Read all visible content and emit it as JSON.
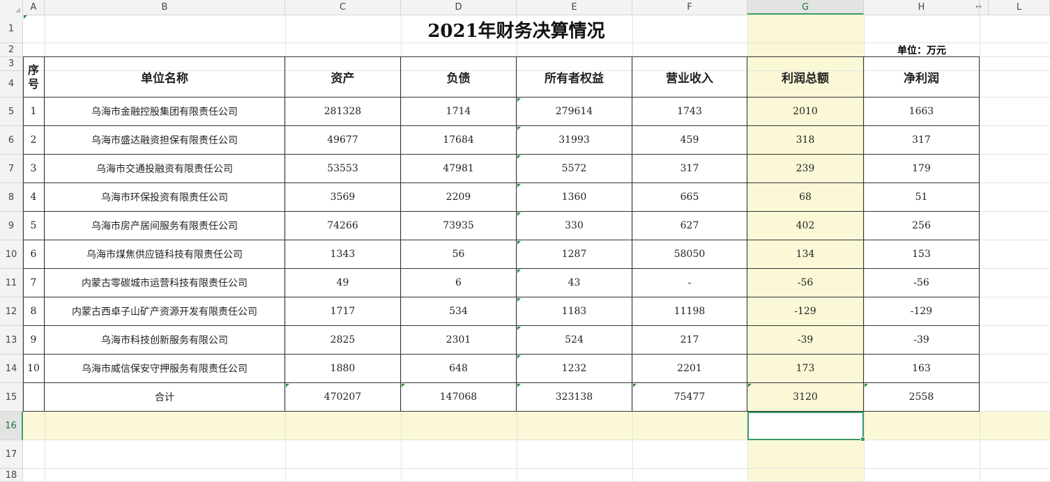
{
  "columns": [
    "A",
    "B",
    "C",
    "D",
    "E",
    "F",
    "G",
    "H",
    "",
    "L"
  ],
  "rows": [
    "1",
    "2",
    "3",
    "4",
    "5",
    "6",
    "7",
    "8",
    "9",
    "10",
    "11",
    "12",
    "13",
    "14",
    "15",
    "16",
    "17",
    "18"
  ],
  "title": "2021年财务决算情况",
  "unit": "单位：万元",
  "headers": {
    "seq": "序号",
    "name": "单位名称",
    "assets": "资产",
    "liabilities": "负债",
    "equity": "所有者权益",
    "revenue": "营业收入",
    "total_profit": "利润总额",
    "net_profit": "净利润"
  },
  "table": [
    {
      "seq": "1",
      "name": "乌海市金融控股集团有限责任公司",
      "assets": "281328",
      "liabilities": "1714",
      "equity": "279614",
      "revenue": "1743",
      "total_profit": "2010",
      "net_profit": "1663"
    },
    {
      "seq": "2",
      "name": "乌海市盛达融资担保有限责任公司",
      "assets": "49677",
      "liabilities": "17684",
      "equity": "31993",
      "revenue": "459",
      "total_profit": "318",
      "net_profit": "317"
    },
    {
      "seq": "3",
      "name": "乌海市交通投融资有限责任公司",
      "assets": "53553",
      "liabilities": "47981",
      "equity": "5572",
      "revenue": "317",
      "total_profit": "239",
      "net_profit": "179"
    },
    {
      "seq": "4",
      "name": "乌海市环保投资有限责任公司",
      "assets": "3569",
      "liabilities": "2209",
      "equity": "1360",
      "revenue": "665",
      "total_profit": "68",
      "net_profit": "51"
    },
    {
      "seq": "5",
      "name": "乌海市房产居间服务有限责任公司",
      "assets": "74266",
      "liabilities": "73935",
      "equity": "330",
      "revenue": "627",
      "total_profit": "402",
      "net_profit": "256"
    },
    {
      "seq": "6",
      "name": "乌海市煤焦供应链科技有限责任公司",
      "assets": "1343",
      "liabilities": "56",
      "equity": "1287",
      "revenue": "58050",
      "total_profit": "134",
      "net_profit": "153"
    },
    {
      "seq": "7",
      "name": "内蒙古零碳城市运营科技有限责任公司",
      "assets": "49",
      "liabilities": "6",
      "equity": "43",
      "revenue": "-",
      "total_profit": "-56",
      "net_profit": "-56"
    },
    {
      "seq": "8",
      "name": "内蒙古西卓子山矿产资源开发有限责任公司",
      "assets": "1717",
      "liabilities": "534",
      "equity": "1183",
      "revenue": "11198",
      "total_profit": "-129",
      "net_profit": "-129"
    },
    {
      "seq": "9",
      "name": "乌海市科技创新服务有限公司",
      "assets": "2825",
      "liabilities": "2301",
      "equity": "524",
      "revenue": "217",
      "total_profit": "-39",
      "net_profit": "-39"
    },
    {
      "seq": "10",
      "name": "乌海市威信保安守押服务有限责任公司",
      "assets": "1880",
      "liabilities": "648",
      "equity": "1232",
      "revenue": "2201",
      "total_profit": "173",
      "net_profit": "163"
    }
  ],
  "total": {
    "name": "合计",
    "assets": "470207",
    "liabilities": "147068",
    "equity": "323138",
    "revenue": "75477",
    "total_profit": "3120",
    "net_profit": "2558"
  },
  "resize_glyph": "↔",
  "colors": {
    "highlight": "#fbf8d7",
    "selection": "#3a9a68",
    "header_bg": "#f3f3f3"
  }
}
